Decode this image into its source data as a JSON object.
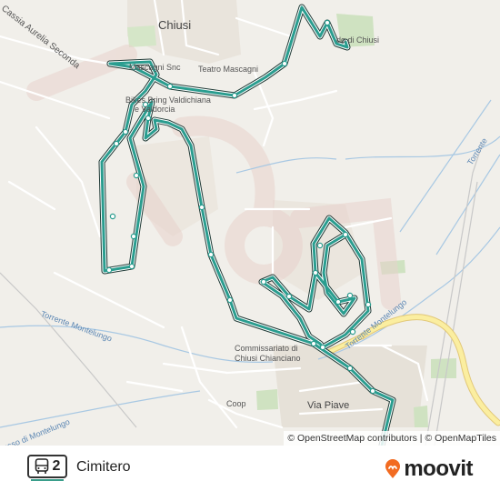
{
  "map": {
    "labels": {
      "chiusi": "Chiusi",
      "cassia": "Cassia Aurelia Seconda",
      "mascagni_snc": "Mascagni Snc",
      "teatro": "Teatro Mascagni",
      "bikes": "Bikes Bring Valdichiana",
      "valdorcia": "e Valdorcia",
      "chiusi_right": "do di Chiusi",
      "torrente_left": "Torrente Montelungo",
      "torrente_right": "Torrente Montelungo",
      "torrente_edge": "Torrente",
      "commissariato": "Commissariato di",
      "chiusi_chianciano": "Chiusi Chianciano",
      "coop": "Coop",
      "via_piave": "Via Piave",
      "fosso": "osso di Montelungo"
    },
    "attribution": "© OpenStreetMap contributors | © OpenMapTiles",
    "route_color": "#2a9d8f",
    "watermark_color": "#e8d2cc"
  },
  "footer": {
    "route_number": "2",
    "route_name": "Cimitero",
    "brand": "moovit",
    "brand_color": "#f26b21",
    "icons": {
      "bus": "bus-icon",
      "logo": "moovit-logo-icon"
    }
  }
}
